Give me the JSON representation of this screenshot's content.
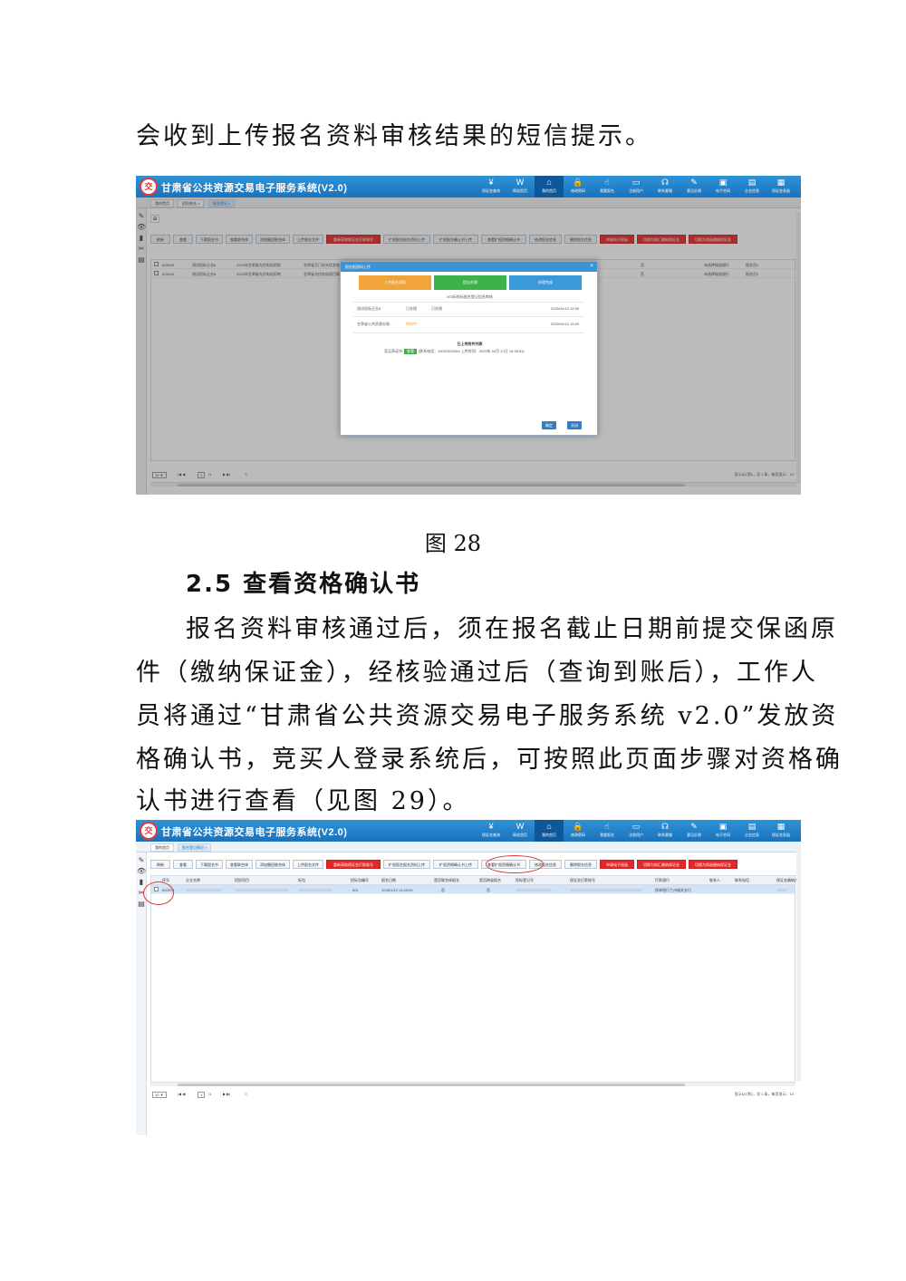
{
  "doc": {
    "line_top": "会收到上传报名资料审核结果的短信提示。",
    "caption": "图 28",
    "heading": "2.5 查看资格确认书",
    "para": [
      "报名资料审核通过后，须在报名截止日期前提交保函原",
      "件（缴纳保证金），经核验通过后（查询到账后），工作人",
      "员将通过“甘肃省公共资源交易电子服务系统 v2.0”发放资",
      "格确认书，竞买人登录系统后，可按照此页面步骤对资格确",
      "认书进行查看（见图 29）。"
    ]
  },
  "app": {
    "title": "甘肃省公共资源交易电子服务系统(V2.0)",
    "logo_text": "交",
    "nav": [
      {
        "icon": "¥",
        "label": "保证金查询"
      },
      {
        "icon": "W",
        "label": "网站首页"
      },
      {
        "icon": "⌂",
        "label": "我的首页"
      },
      {
        "icon": "🔒",
        "label": "修改密码"
      },
      {
        "icon": "☝",
        "label": "我要报名"
      },
      {
        "icon": "▭",
        "label": "注册用户"
      },
      {
        "icon": "☊",
        "label": "联系客服"
      },
      {
        "icon": "✎",
        "label": "意见反馈"
      },
      {
        "icon": "▣",
        "label": "电子合同"
      },
      {
        "icon": "▤",
        "label": "企业信息"
      },
      {
        "icon": "▦",
        "label": "保证金发函"
      }
    ],
    "sidebar_icons": [
      "»",
      "✎",
      "👁",
      "▮",
      "✂",
      "▤"
    ]
  },
  "shot1": {
    "tabs": [
      "我的首页",
      "招投报名 ×",
      "报名登记 ×"
    ],
    "buttons": [
      {
        "label": "刷新",
        "red": false
      },
      {
        "label": "查看",
        "red": false
      },
      {
        "label": "下载报名书",
        "red": false
      },
      {
        "label": "查看联合体",
        "red": false
      },
      {
        "label": "添加撤回联合体",
        "red": false
      },
      {
        "label": "上传报名文件",
        "red": false
      },
      {
        "label": "重新获取保证金打款账号",
        "red": true
      },
      {
        "label": "扩权报名报名资料上传",
        "red": false
      },
      {
        "label": "扩权报名确认书上传",
        "red": false
      },
      {
        "label": "查看扩权资格确认书",
        "red": false
      },
      {
        "label": "修改报名信息",
        "red": false
      },
      {
        "label": "删除报名信息",
        "red": false
      },
      {
        "label": "申请电子保函",
        "red": true
      },
      {
        "label": "切换为纯汇缴纳保证金",
        "red": true
      },
      {
        "label": "切换为保函缴纳保证金",
        "red": true
      }
    ],
    "rows": [
      {
        "id": "625044",
        "company": "测试投标企业8",
        "project": "2024年甘肃省光伏电站用地",
        "item": "甘肃省玉门市光伏发电项目",
        "col5": "否",
        "col6": "未选择保函银行",
        "col7": "报名员2"
      },
      {
        "id": "625043",
        "company": "测试投标企业8",
        "project": "2024年甘肃省光伏电站用地",
        "item": "甘肃省光伏电站项目第二阶段",
        "col5": "否",
        "col6": "未选择保函银行",
        "col7": "报名员2"
      }
    ],
    "pager": {
      "size": "10 ▼",
      "page": "1",
      "total": "/1",
      "info": "显示从1到1，总 1 条，每页显示：10"
    },
    "modal": {
      "title": "报名报资料上传",
      "steps": [
        {
          "label": "上传报名资料",
          "color": "#f0a43a"
        },
        {
          "label": "提交办理",
          "color": "#3db24a"
        },
        {
          "label": "办理完成",
          "color": "#3a9ad9"
        }
      ],
      "subtitle": "003标投标报名登记信息审核",
      "records": [
        {
          "name": "测试投标企业8",
          "status": "已办理",
          "status2": "已办理",
          "time": "2025/04/10 15:09",
          "orange": false
        },
        {
          "name": "甘肃省公共资源交易...",
          "status": "审核中",
          "status2": "",
          "time": "2025/04/10 15:09",
          "orange": true
        }
      ],
      "files_title": "已上传附件列表",
      "file_label": "竞买承诺书",
      "file_tag": "查看",
      "file_info": "[联系电话：15002643454 上传时间：2025年 04月 10日 15:38:51]",
      "ok": "确定",
      "close": "关闭"
    }
  },
  "shot2": {
    "tabs": [
      "我的首页",
      "报名登记情况 ×"
    ],
    "buttons": [
      {
        "label": "刷新",
        "red": false
      },
      {
        "label": "查看",
        "red": false
      },
      {
        "label": "下载报名书",
        "red": false
      },
      {
        "label": "查看联合体",
        "red": false
      },
      {
        "label": "添加撤回联合体",
        "red": false
      },
      {
        "label": "上传报名文件",
        "red": false
      },
      {
        "label": "重新获取保证金打款账号",
        "red": true
      },
      {
        "label": "扩权报名报名资料上传",
        "red": false
      },
      {
        "label": "扩权资格确认书上传",
        "red": false
      },
      {
        "label": "查看扩权资格确认书",
        "red": false
      },
      {
        "label": "修改报名信息",
        "red": false
      },
      {
        "label": "删除报名信息",
        "red": false
      },
      {
        "label": "申请电子保函",
        "red": true
      },
      {
        "label": "切换为纯汇缴纳保证金",
        "red": true
      },
      {
        "label": "切换为保函缴纳保证金",
        "red": true
      }
    ],
    "columns": [
      "序号",
      "企业名称",
      "招投项目",
      "标包",
      "招标包编号",
      "报名日期",
      "是否联合体报名",
      "是否跨省报名",
      "投标登记号",
      "保证金打款账号",
      "打款银行",
      "联系人",
      "联系电话",
      "保证金缴纳方式"
    ],
    "row": {
      "id": "620973",
      "bid_no": "001",
      "date": "2025/1/12 13:49:00",
      "joint": "否",
      "cross": "否",
      "bank": "保单银行兰州城关支行"
    },
    "pager": {
      "size": "10 ▼",
      "page": "1",
      "total": "/1",
      "info": "显示从1到1，总 1 条，每页显示：10"
    }
  }
}
